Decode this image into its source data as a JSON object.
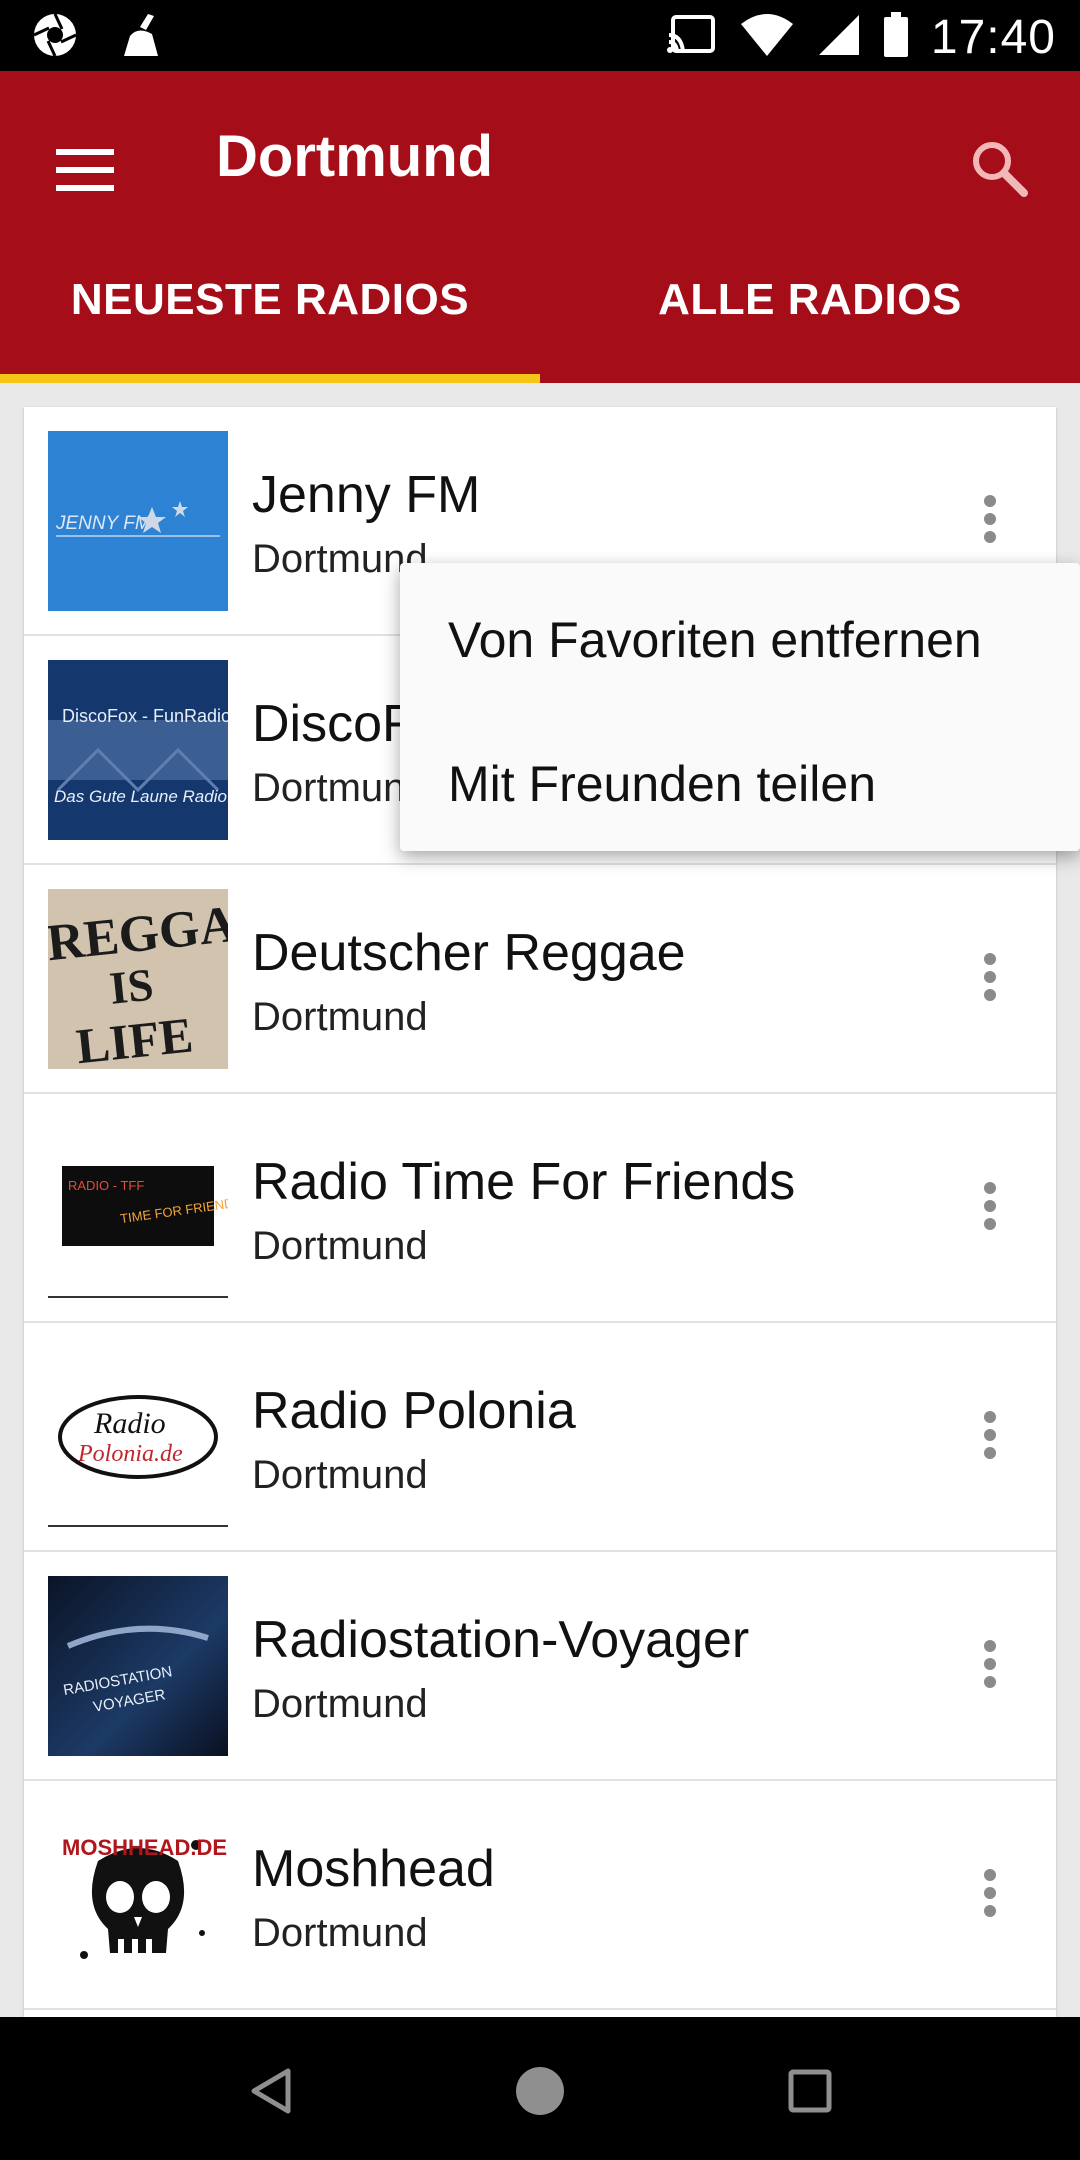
{
  "status_bar": {
    "time": "17:40",
    "left_icons": [
      "aperture-icon",
      "cleaner-broom-icon"
    ],
    "right_icons": [
      "cast-icon",
      "wifi-icon",
      "signal-icon",
      "battery-icon"
    ]
  },
  "app_bar": {
    "title": "Dortmund",
    "menu_icon": "hamburger-menu-icon",
    "search_icon": "search-icon",
    "background_color": "#a50e19",
    "indicator_color": "#f5c518"
  },
  "tabs": [
    {
      "label": "NEUESTE RADIOS",
      "selected": true
    },
    {
      "label": "ALLE RADIOS",
      "selected": false
    }
  ],
  "stations": [
    {
      "name": "Jenny FM",
      "city": "Dortmund",
      "logo_text": "JENNY FM",
      "logo": "jenny-fm-logo"
    },
    {
      "name": "DiscoFox",
      "city": "Dortmund",
      "logo_text": "DiscoFox - FunRadio",
      "logo_text2": "Das Gute Laune Radio",
      "logo": "discofox-logo"
    },
    {
      "name": "Deutscher Reggae",
      "city": "Dortmund",
      "logo_text": "REGGAE",
      "logo_text2": "IS",
      "logo_text3": "LIFE",
      "logo": "reggae-logo"
    },
    {
      "name": "Radio Time For Friends",
      "city": "Dortmund",
      "logo_text": "RADIO - TFF",
      "logo_text2": "TIME FOR FRIENDS",
      "logo": "time-for-friends-logo"
    },
    {
      "name": "Radio Polonia",
      "city": "Dortmund",
      "logo_text": "Radio",
      "logo_text2": "Polonia.de",
      "logo": "polonia-logo"
    },
    {
      "name": "Radiostation-Voyager",
      "city": "Dortmund",
      "logo_text": "RADIOSTATION",
      "logo_text2": "VOYAGER",
      "logo": "voyager-logo"
    },
    {
      "name": "Moshhead",
      "city": "Dortmund",
      "logo_text": "MOSHHEAD.DE",
      "logo": "moshhead-skull-logo"
    }
  ],
  "popup_menu": {
    "items": [
      "Von Favoriten entfernen",
      "Mit Freunden teilen"
    ]
  },
  "nav_bar": {
    "icons": [
      "back-triangle-icon",
      "home-circle-icon",
      "recents-square-icon"
    ]
  }
}
